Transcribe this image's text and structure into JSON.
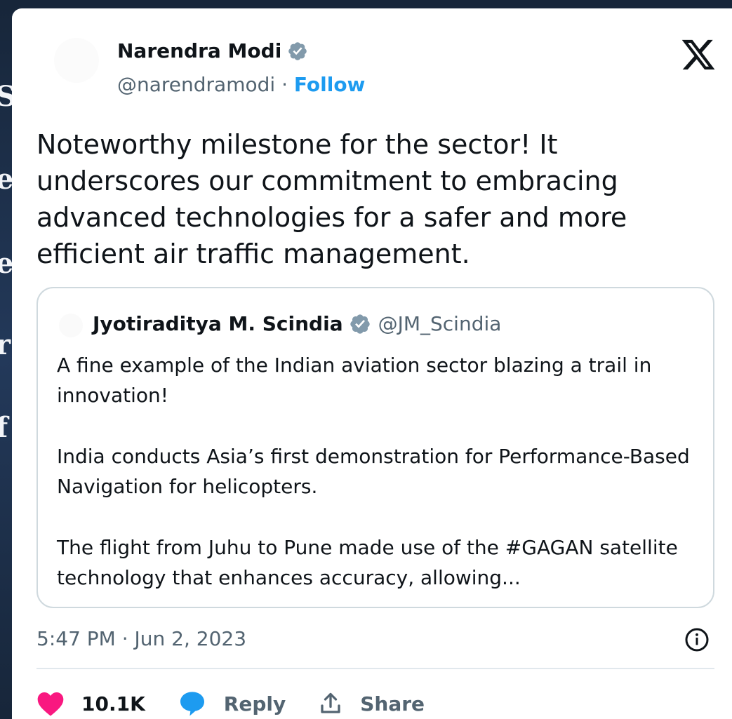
{
  "background": {
    "fragments": [
      "S",
      "e",
      "e",
      "r",
      "f"
    ]
  },
  "tweet": {
    "author_name": "Narendra Modi",
    "handle": "@narendramodi",
    "separator": " · ",
    "follow_label": "Follow",
    "text": "Noteworthy milestone for the sector! It\nunderscores our commitment to embracing\nadvanced technologies for a safer and more\nefficient air traffic management.",
    "timestamp": "5:47 PM · Jun 2, 2023"
  },
  "quoted_tweet": {
    "author_name": "Jyotiraditya M. Scindia",
    "handle": "@JM_Scindia",
    "paragraphs": [
      "A fine example of the Indian aviation sector blazing a trail in innovation!",
      "India conducts Asia’s first demonstration for Performance-Based Navigation for helicopters.",
      "The flight from Juhu to Pune made use of the #GAGAN satellite technology that enhances accuracy, allowing..."
    ]
  },
  "actions": {
    "likes": "10.1K",
    "reply_label": "Reply",
    "share_label": "Share"
  },
  "colors": {
    "verified": "#829aab",
    "follow": "#1d9bf0",
    "like": "#f91880",
    "reply": "#1d9bf0"
  },
  "icons": [
    "verified-badge-icon",
    "x-logo-icon",
    "info-icon",
    "heart-icon",
    "speech-bubble-icon",
    "share-upload-icon"
  ]
}
